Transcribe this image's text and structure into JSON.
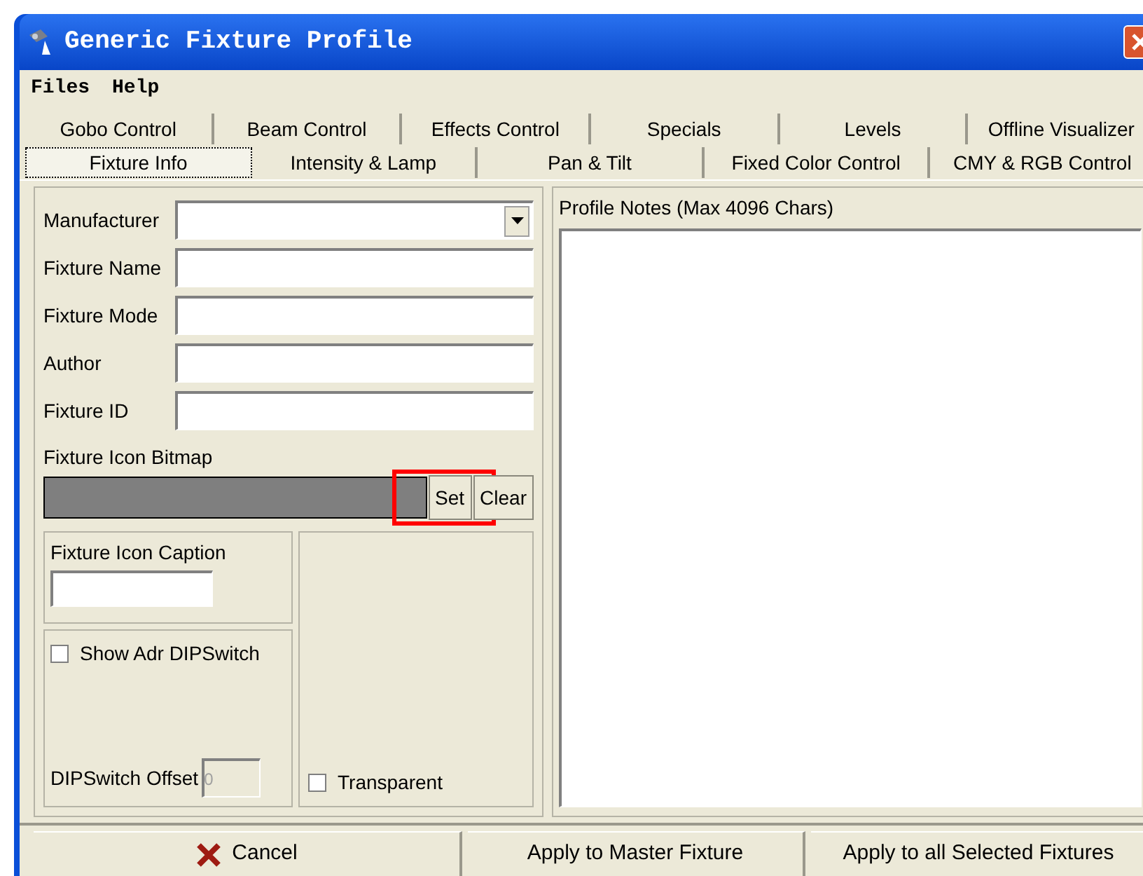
{
  "window": {
    "title": "Generic Fixture Profile"
  },
  "menu": [
    "Files",
    "Help"
  ],
  "tab_rows": [
    [
      {
        "label": "Gobo Control",
        "selected": false
      },
      {
        "label": "Beam Control",
        "selected": false
      },
      {
        "label": "Effects Control",
        "selected": false
      },
      {
        "label": "Specials",
        "selected": false
      },
      {
        "label": "Levels",
        "selected": false
      },
      {
        "label": "Offline Visualizer",
        "selected": false
      }
    ],
    [
      {
        "label": "Fixture Info",
        "selected": true
      },
      {
        "label": "Intensity & Lamp",
        "selected": false
      },
      {
        "label": "Pan & Tilt",
        "selected": false
      },
      {
        "label": "Fixed Color Control",
        "selected": false
      },
      {
        "label": "CMY & RGB Control",
        "selected": false
      }
    ]
  ],
  "fields": [
    {
      "label": "Manufacturer",
      "kind": "dropdown"
    },
    {
      "label": "Fixture Name",
      "kind": "text"
    },
    {
      "label": "Fixture Mode",
      "kind": "text"
    },
    {
      "label": "Author",
      "kind": "text"
    },
    {
      "label": "Fixture ID",
      "kind": "text"
    }
  ],
  "bitmap": {
    "label": "Fixture Icon Bitmap",
    "buttons": [
      {
        "label": "Set",
        "highlighted": true
      },
      {
        "label": "Clear",
        "highlighted": false
      }
    ]
  },
  "caption": {
    "label": "Fixture Icon Caption"
  },
  "show_dip": {
    "label": "Show Adr DIPSwitch",
    "checked": false
  },
  "dip_offset": {
    "label": "DIPSwitch Offset",
    "value": "0",
    "disabled": true
  },
  "transparent": {
    "label": "Transparent",
    "checked": false
  },
  "notes": {
    "label": "Profile Notes (Max 4096 Chars)"
  },
  "buttons": [
    {
      "label": "Cancel",
      "kind": "cancel"
    },
    {
      "label": "Apply to Master Fixture",
      "kind": "plain"
    },
    {
      "label": "Apply to all Selected Fixtures",
      "kind": "plain"
    }
  ]
}
